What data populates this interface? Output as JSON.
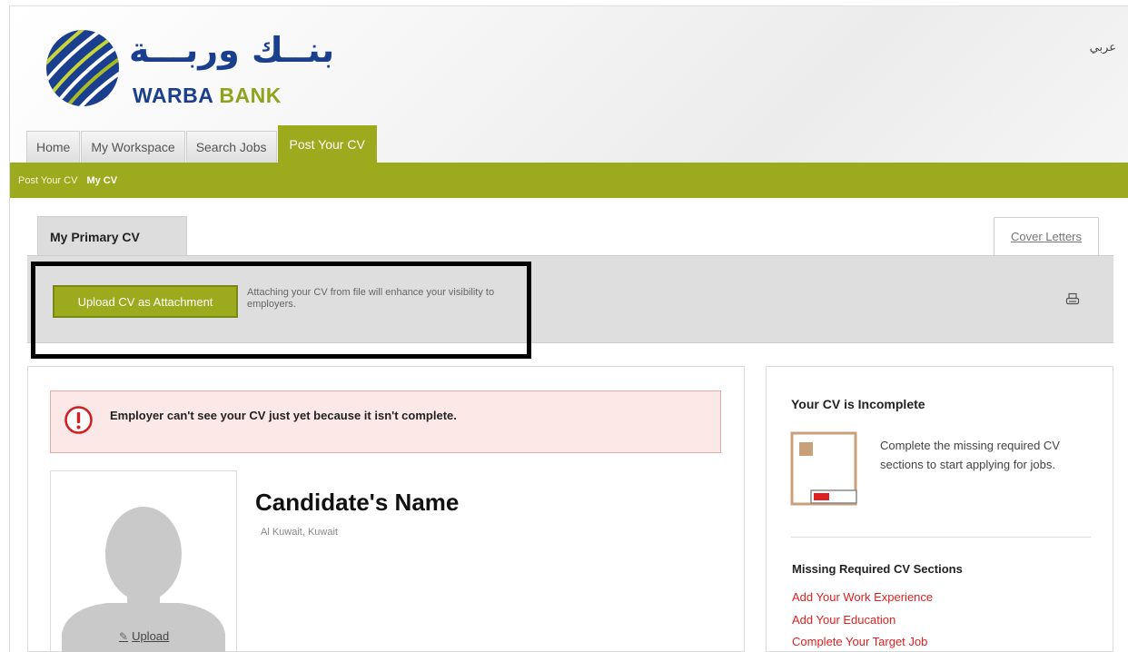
{
  "header": {
    "language_toggle": "عربي",
    "logo_arabic": "بنــك وربـــة",
    "logo_english_1": "WARBA",
    "logo_english_2": "BANK"
  },
  "nav": {
    "tabs": [
      {
        "label": "Home",
        "active": false
      },
      {
        "label": "My Workspace",
        "active": false
      },
      {
        "label": "Search Jobs",
        "active": false
      },
      {
        "label": "Post Your CV",
        "active": true
      }
    ]
  },
  "subnav": {
    "items": [
      "Post Your CV",
      "My CV"
    ]
  },
  "cv_tabs": {
    "primary": "My Primary CV",
    "cover_letters": "Cover Letters"
  },
  "upload": {
    "button_label": "Upload CV as Attachment",
    "hint": "Attaching your CV from file will enhance your visibility to employers."
  },
  "alert": {
    "message": "Employer can't see your CV just yet because it isn't complete."
  },
  "profile": {
    "photo_upload_label": "Upload",
    "name": "Candidate's Name",
    "location": "Al Kuwait, Kuwait"
  },
  "sidebar": {
    "title": "Your CV is Incomplete",
    "description": "Complete the missing required CV sections to start applying for jobs.",
    "missing_title": "Missing Required CV Sections",
    "missing_items": [
      "Add Your Work Experience",
      "Add Your Education",
      "Complete Your Target Job"
    ]
  },
  "colors": {
    "brand_green": "#9bab1d",
    "brand_blue": "#1b3f8f",
    "alert_red": "#e02020"
  },
  "icons": [
    "warba-logo-icon",
    "print-icon",
    "alert-exclamation-icon",
    "pencil-icon",
    "avatar-silhouette-icon",
    "cv-progress-icon"
  ]
}
